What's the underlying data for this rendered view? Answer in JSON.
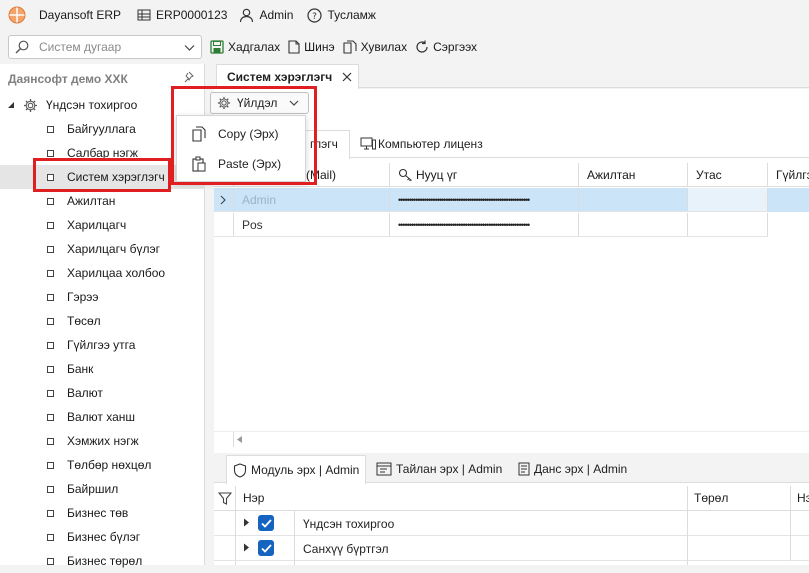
{
  "topbar": {
    "app_name": "Dayansoft ERP",
    "code": "ERP0000123",
    "user": "Admin",
    "help": "Тусламж"
  },
  "search": {
    "placeholder": "Систем дугаар"
  },
  "toolbar": {
    "save": "Хадгалах",
    "new": "Шинэ",
    "copy": "Хувилах",
    "refresh": "Сэргээх"
  },
  "sidebar": {
    "header": "Даянсофт демо ХХК",
    "root": "Үндсэн тохиргоо",
    "items": [
      "Байгууллага",
      "Салбар нэгж",
      "Систем хэрэглэгч",
      "Ажилтан",
      "Харилцагч",
      "Харилцагч бүлэг",
      "Харилцаа холбоо",
      "Гэрээ",
      "Төсөл",
      "Гүйлгээ утга",
      "Банк",
      "Валют",
      "Валют ханш",
      "Хэмжих нэгж",
      "Төлбөр нөхцөл",
      "Байршил",
      "Бизнес төв",
      "Бизнес бүлэг",
      "Бизнес төрөл"
    ]
  },
  "doc_tab": {
    "label": "Систем хэрэглэгч"
  },
  "actions_button": {
    "label": "Үйлдэл"
  },
  "menu": {
    "items": [
      "Copy (Эрх)",
      "Paste (Эрх)"
    ]
  },
  "subtabs": {
    "first_partial": "глэгч",
    "second": "Компьютер лиценз"
  },
  "grid": {
    "columns": [
      "(Mail)",
      "Нууц үг",
      "Ажилтан",
      "Утас",
      "Гүйлгэ"
    ],
    "rows": [
      {
        "name": "Admin",
        "password": "•••••••••••••••••••••••••••••••••••••••••••••••••••••••••••••",
        "employee": "",
        "phone": ""
      },
      {
        "name": "Pos",
        "password": "•••••••••••••••••••••••••••••••••••••••••••••••••••••••••••••",
        "employee": "",
        "phone": ""
      }
    ]
  },
  "bottom_tabs": [
    "Модуль эрх | Admin",
    "Тайлан эрх | Admin",
    "Данс эрх | Admin"
  ],
  "rights_tree": {
    "columns": [
      "Нэр",
      "Төрөл",
      "Нэ"
    ],
    "rows": [
      {
        "name": "Үндсэн тохиргоо",
        "checked": true
      },
      {
        "name": "Санхүү бүртгэл",
        "checked": true
      }
    ]
  },
  "colors": {
    "accent": "#1565c0",
    "highlight": "#e02020",
    "selected_row": "#cce4f7"
  }
}
